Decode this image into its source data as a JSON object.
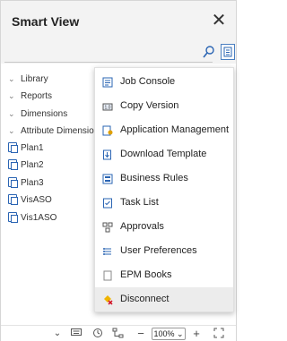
{
  "header": {
    "title": "Smart View",
    "close_icon": "close-icon"
  },
  "search": {
    "value": "",
    "icon": "search-icon",
    "menu_icon": "menu-toggle-icon"
  },
  "tree": {
    "folders": [
      "Library",
      "Reports",
      "Dimensions",
      "Attribute Dimensions"
    ],
    "plans": [
      "Plan1",
      "Plan2",
      "Plan3",
      "VisASO",
      "Vis1ASO"
    ]
  },
  "menu": {
    "items": [
      {
        "label": "Job Console",
        "icon": "job-console-icon"
      },
      {
        "label": "Copy Version",
        "icon": "copy-version-icon"
      },
      {
        "label": "Application Management",
        "icon": "application-management-icon"
      },
      {
        "label": "Download Template",
        "icon": "download-template-icon"
      },
      {
        "label": "Business Rules",
        "icon": "business-rules-icon"
      },
      {
        "label": "Task List",
        "icon": "task-list-icon"
      },
      {
        "label": "Approvals",
        "icon": "approvals-icon"
      },
      {
        "label": "User Preferences",
        "icon": "user-preferences-icon"
      },
      {
        "label": "EPM Books",
        "icon": "epm-books-icon"
      },
      {
        "label": "Disconnect",
        "icon": "disconnect-icon"
      }
    ],
    "hovered": "Disconnect"
  },
  "footer": {
    "zoom": "100%",
    "zoom_chevron": "⌄",
    "minus": "−",
    "plus": "+",
    "chevron": "⌄"
  },
  "colors": {
    "accent": "#2a64b3",
    "header_bg": "#f3f3f3",
    "hover_bg": "#ececec"
  }
}
